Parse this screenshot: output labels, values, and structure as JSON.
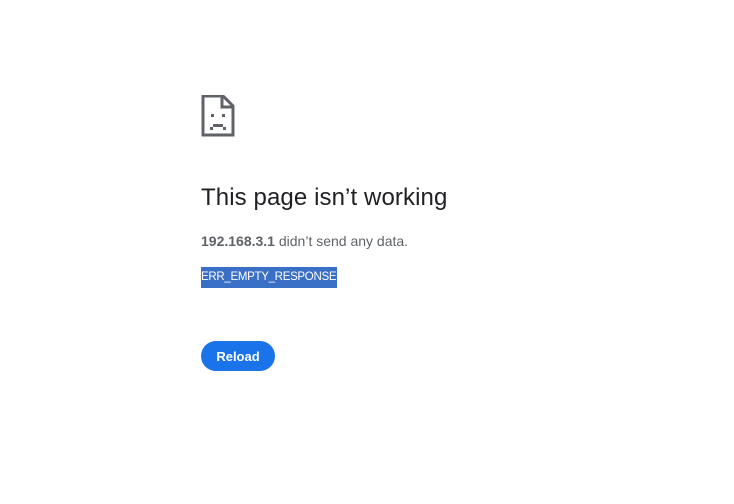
{
  "error_icon": {
    "name": "sad-document-icon"
  },
  "headline": "This page isn’t working",
  "message": {
    "host": "192.168.3.1",
    "text": " didn’t send any data."
  },
  "error_code": "ERR_EMPTY_RESPONSE",
  "reload_button": {
    "label": "Reload"
  },
  "colors": {
    "accent": "#1a73e8",
    "text_primary": "#202124",
    "text_secondary": "#5f6368",
    "selection": "#3a6fc6"
  }
}
